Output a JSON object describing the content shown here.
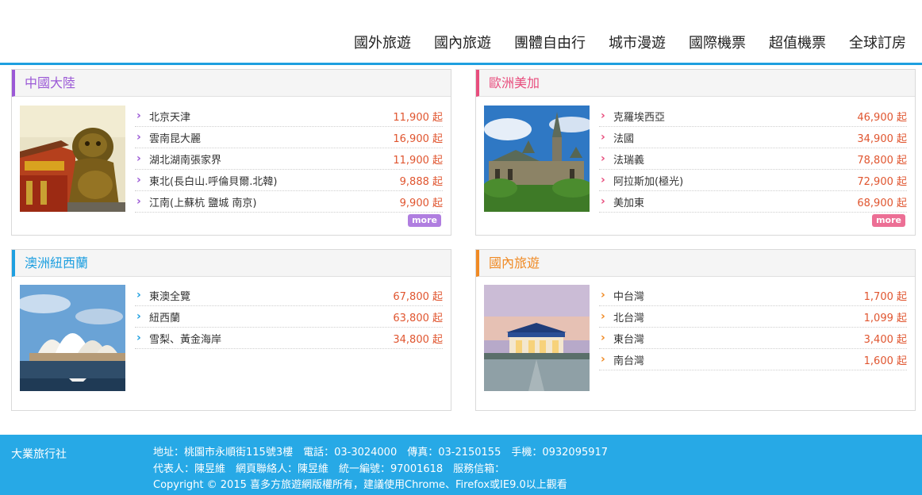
{
  "nav": {
    "items": [
      "國外旅遊",
      "國內旅遊",
      "團體自由行",
      "城市漫遊",
      "國際機票",
      "超值機票",
      "全球訂房"
    ]
  },
  "colors": {
    "nav_border": "#1e9fe0",
    "price": "#e0552f",
    "footer_bg": "#27a9e6"
  },
  "panels": [
    {
      "title": "中國大陸",
      "accent": "#9b59d6",
      "more_color": "#b07ee0",
      "photo": "forbidden-city-lion-photo",
      "items": [
        {
          "name": "北京天津",
          "price": "11,900 起"
        },
        {
          "name": "雲南昆大麗",
          "price": "16,900 起"
        },
        {
          "name": "湖北湖南張家界",
          "price": "11,900 起"
        },
        {
          "name": "東北(長白山.呼倫貝爾.北韓)",
          "price": "9,888 起"
        },
        {
          "name": "江南(上蘇杭 鹽城 南京)",
          "price": "9,900 起"
        }
      ],
      "more": "more"
    },
    {
      "title": "歐洲美加",
      "accent": "#e84d7d",
      "more_color": "#ec6f95",
      "photo": "parliament-hill-photo",
      "items": [
        {
          "name": "克羅埃西亞",
          "price": "46,900 起"
        },
        {
          "name": "法國",
          "price": "34,900 起"
        },
        {
          "name": "法瑞義",
          "price": "78,800 起"
        },
        {
          "name": "阿拉斯加(極光)",
          "price": "72,900 起"
        },
        {
          "name": "美加東",
          "price": "68,900 起"
        }
      ],
      "more": "more"
    },
    {
      "title": "澳洲紐西蘭",
      "accent": "#1e9fe0",
      "photo": "sydney-opera-house-photo",
      "items": [
        {
          "name": "東澳全覽",
          "price": "67,800 起"
        },
        {
          "name": "紐西蘭",
          "price": "63,800 起"
        },
        {
          "name": "雪梨、黃金海岸",
          "price": "34,800 起"
        }
      ]
    },
    {
      "title": "國內旅遊",
      "accent": "#f08a24",
      "photo": "memorial-hall-photo",
      "items": [
        {
          "name": "中台灣",
          "price": "1,700 起"
        },
        {
          "name": "北台灣",
          "price": "1,099 起"
        },
        {
          "name": "東台灣",
          "price": "3,400 起"
        },
        {
          "name": "南台灣",
          "price": "1,600 起"
        }
      ]
    }
  ],
  "footer": {
    "brand": "大業旅行社",
    "lines": [
      "地址：桃園市永順街115號3樓　電話：03-3024000　傳真：03-2150155　手機：0932095917",
      "代表人：陳昱維　網頁聯絡人：陳昱維　統一編號：97001618　服務信箱：",
      "Copyright © 2015 喜多方旅遊網版權所有，建議使用Chrome、Firefox或IE9.0以上觀看"
    ]
  }
}
